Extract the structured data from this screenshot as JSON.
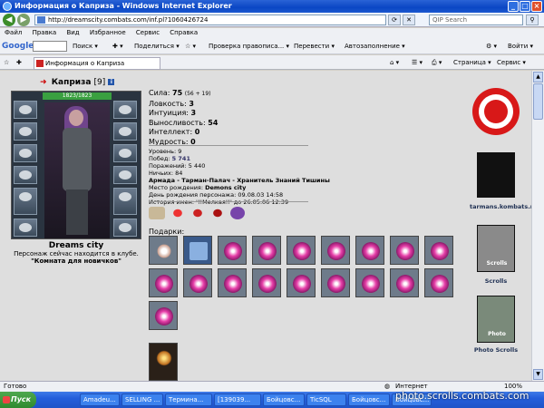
{
  "window": {
    "title": "Информация о Каприза - Windows Internet Explorer"
  },
  "address": {
    "url": "http://dreamscity.combats.com/inf.pl?1060426724",
    "search_placeholder": "QIP Search"
  },
  "menu": [
    "Файл",
    "Правка",
    "Вид",
    "Избранное",
    "Сервис",
    "Справка"
  ],
  "gbar": {
    "logo": "Google",
    "search": "Поиск",
    "share": "Поделиться",
    "spell": "Проверка правописа...",
    "translate": "Перевести",
    "autofill": "Автозаполнение",
    "login": "Войти"
  },
  "tab": {
    "title": "Информация о Каприза",
    "page_menu": "Страница",
    "tools_menu": "Сервис"
  },
  "character": {
    "name": "Каприза",
    "level": "[9]",
    "hp": "1823/1823",
    "city": "Dreams city",
    "note": "Персонаж сейчас находится в клубе.",
    "room": "\"Комната для новичков\""
  },
  "stats": [
    {
      "label": "Сила:",
      "value": "75",
      "bonus": "(56 + 19)"
    },
    {
      "label": "Ловкость:",
      "value": "3",
      "bonus": ""
    },
    {
      "label": "Интуиция:",
      "value": "3",
      "bonus": ""
    },
    {
      "label": "Выносливость:",
      "value": "54",
      "bonus": ""
    },
    {
      "label": "Интеллект:",
      "value": "0",
      "bonus": ""
    },
    {
      "label": "Мудрость:",
      "value": "0",
      "bonus": ""
    }
  ],
  "info": {
    "level": "Уровень: 9",
    "wins_label": "Побед: ",
    "wins": "5 741",
    "losses": "Поражений: 5 440",
    "draws": "Ничьих: 84",
    "army": "Армада - Тарман-Палач - Хранитель Знаний Тишины",
    "birthplace_label": "Место рождения: ",
    "birthplace": "Demons city",
    "birthday": "День рождения персонажа: 09.08.03 14:58",
    "history": "История имен: '!!Мелкая!!' до 26.05.06 12:39"
  },
  "gifts": {
    "label": "Подарки:"
  },
  "sidebar": {
    "tarmans": "tarmans.kombats.ru",
    "scrolls": "Scrolls",
    "photo": "Photo Scrolls",
    "scrolls_banner": "Scrolls",
    "photo_banner": "Photo"
  },
  "status": {
    "ready": "Готово",
    "zone": "Интернет",
    "zoom": "100%"
  },
  "taskbar": {
    "start": "Пуск",
    "items": [
      "Amadeu...",
      "SELLING ...",
      "Термина...",
      "[139039...",
      "Бойцовс...",
      "TicSQL",
      "Бойцовс...",
      "Бойцовс..."
    ]
  },
  "watermark": "photo.scrolls.combats.com",
  "colors": {
    "accent": "#cc0000",
    "hp": "#3aa040",
    "taskbar": "#245edb"
  }
}
